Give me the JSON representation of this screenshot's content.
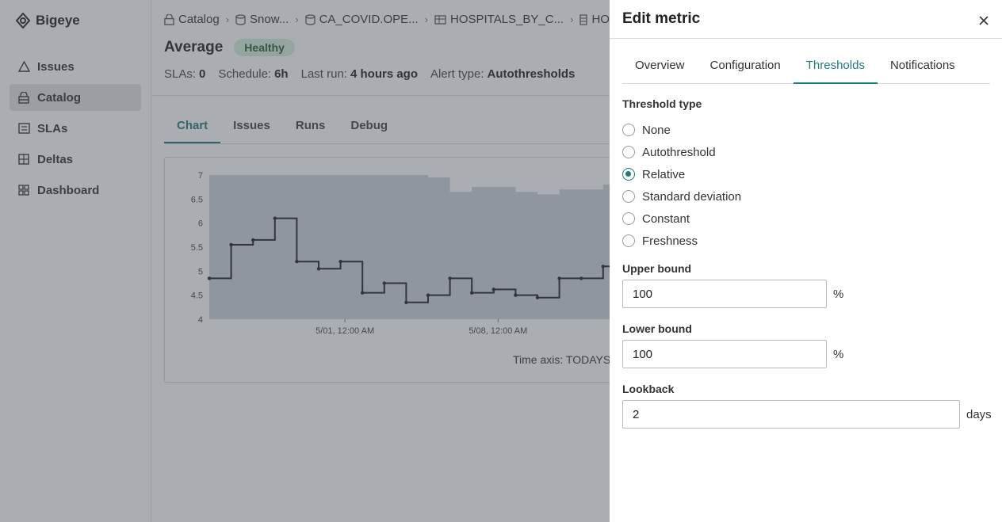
{
  "app": {
    "brand": "Bigeye",
    "nav": [
      {
        "label": "Issues",
        "icon": "warning-icon",
        "active": false
      },
      {
        "label": "Catalog",
        "icon": "catalog-icon",
        "active": true
      },
      {
        "label": "SLAs",
        "icon": "sla-icon",
        "active": false
      },
      {
        "label": "Deltas",
        "icon": "deltas-icon",
        "active": false
      },
      {
        "label": "Dashboard",
        "icon": "dashboard-icon",
        "active": false
      }
    ]
  },
  "breadcrumb": [
    {
      "label": "Catalog",
      "icon": "catalog-icon"
    },
    {
      "label": "Snow...",
      "icon": "database-icon"
    },
    {
      "label": "CA_COVID.OPE...",
      "icon": "schema-icon"
    },
    {
      "label": "HOSPITALS_BY_C...",
      "icon": "table-icon"
    },
    {
      "label": "HOSP",
      "icon": "column-icon"
    }
  ],
  "metric": {
    "title": "Average",
    "status": "Healthy",
    "sla_label": "SLAs:",
    "sla_value": "0",
    "schedule_label": "Schedule:",
    "schedule_value": "6h",
    "last_run_label": "Last run:",
    "last_run_value": "4 hours ago",
    "alert_label": "Alert type:",
    "alert_value": "Autothresholds"
  },
  "main_tabs": [
    {
      "label": "Chart",
      "active": true
    },
    {
      "label": "Issues",
      "active": false
    },
    {
      "label": "Runs",
      "active": false
    },
    {
      "label": "Debug",
      "active": false
    }
  ],
  "chart_data": {
    "type": "line",
    "y_ticks": [
      "7",
      "6.5",
      "6",
      "5.5",
      "5",
      "4.5",
      "4"
    ],
    "ylim": [
      4,
      7
    ],
    "x_ticks": [
      "5/01, 12:00 AM",
      "5/08, 12:00 AM"
    ],
    "x": [
      0,
      1,
      2,
      3,
      4,
      5,
      6,
      7,
      8,
      9,
      10,
      11,
      12,
      13,
      14,
      15,
      16,
      17,
      18
    ],
    "values": [
      4.85,
      5.55,
      5.65,
      6.1,
      5.2,
      5.05,
      5.2,
      4.55,
      4.75,
      4.35,
      4.5,
      4.85,
      4.55,
      4.62,
      4.5,
      4.45,
      4.85,
      4.85,
      5.1
    ],
    "band_upper": [
      7.0,
      7.0,
      7.0,
      7.0,
      7.0,
      7.0,
      7.0,
      7.0,
      7.0,
      7.0,
      6.95,
      6.65,
      6.75,
      6.75,
      6.65,
      6.6,
      6.7,
      6.7,
      6.8
    ],
    "band_lower": [
      4,
      4,
      4,
      4,
      4,
      4,
      4,
      4,
      4,
      4,
      4,
      4,
      4,
      4,
      4,
      4,
      4,
      4,
      4
    ],
    "time_axis_label": "Time axis: TODAYS",
    "colors": {
      "line": "#222222",
      "band": "#cdd2d8"
    }
  },
  "drawer": {
    "title": "Edit metric",
    "tabs": [
      {
        "label": "Overview",
        "active": false
      },
      {
        "label": "Configuration",
        "active": false
      },
      {
        "label": "Thresholds",
        "active": true
      },
      {
        "label": "Notifications",
        "active": false
      }
    ],
    "threshold_type_label": "Threshold type",
    "threshold_options": [
      {
        "label": "None",
        "checked": false
      },
      {
        "label": "Autothreshold",
        "checked": false
      },
      {
        "label": "Relative",
        "checked": true
      },
      {
        "label": "Standard deviation",
        "checked": false
      },
      {
        "label": "Constant",
        "checked": false
      },
      {
        "label": "Freshness",
        "checked": false
      }
    ],
    "upper_bound": {
      "label": "Upper bound",
      "value": "100",
      "unit": "%"
    },
    "lower_bound": {
      "label": "Lower bound",
      "value": "100",
      "unit": "%"
    },
    "lookback": {
      "label": "Lookback",
      "value": "2",
      "unit": "days"
    }
  },
  "colors": {
    "accent": "#237a7a",
    "badge_bg": "#d7ecd8"
  }
}
